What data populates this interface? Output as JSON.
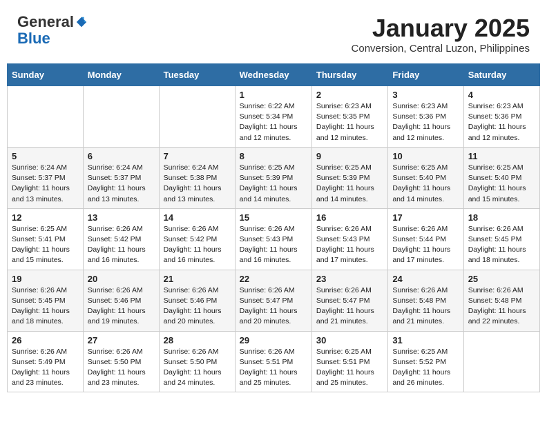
{
  "header": {
    "logo_line1": "General",
    "logo_line2": "Blue",
    "title": "January 2025",
    "location": "Conversion, Central Luzon, Philippines"
  },
  "weekdays": [
    "Sunday",
    "Monday",
    "Tuesday",
    "Wednesday",
    "Thursday",
    "Friday",
    "Saturday"
  ],
  "weeks": [
    [
      {
        "day": "",
        "sunrise": "",
        "sunset": "",
        "daylight": ""
      },
      {
        "day": "",
        "sunrise": "",
        "sunset": "",
        "daylight": ""
      },
      {
        "day": "",
        "sunrise": "",
        "sunset": "",
        "daylight": ""
      },
      {
        "day": "1",
        "sunrise": "Sunrise: 6:22 AM",
        "sunset": "Sunset: 5:34 PM",
        "daylight": "Daylight: 11 hours and 12 minutes."
      },
      {
        "day": "2",
        "sunrise": "Sunrise: 6:23 AM",
        "sunset": "Sunset: 5:35 PM",
        "daylight": "Daylight: 11 hours and 12 minutes."
      },
      {
        "day": "3",
        "sunrise": "Sunrise: 6:23 AM",
        "sunset": "Sunset: 5:36 PM",
        "daylight": "Daylight: 11 hours and 12 minutes."
      },
      {
        "day": "4",
        "sunrise": "Sunrise: 6:23 AM",
        "sunset": "Sunset: 5:36 PM",
        "daylight": "Daylight: 11 hours and 12 minutes."
      }
    ],
    [
      {
        "day": "5",
        "sunrise": "Sunrise: 6:24 AM",
        "sunset": "Sunset: 5:37 PM",
        "daylight": "Daylight: 11 hours and 13 minutes."
      },
      {
        "day": "6",
        "sunrise": "Sunrise: 6:24 AM",
        "sunset": "Sunset: 5:37 PM",
        "daylight": "Daylight: 11 hours and 13 minutes."
      },
      {
        "day": "7",
        "sunrise": "Sunrise: 6:24 AM",
        "sunset": "Sunset: 5:38 PM",
        "daylight": "Daylight: 11 hours and 13 minutes."
      },
      {
        "day": "8",
        "sunrise": "Sunrise: 6:25 AM",
        "sunset": "Sunset: 5:39 PM",
        "daylight": "Daylight: 11 hours and 14 minutes."
      },
      {
        "day": "9",
        "sunrise": "Sunrise: 6:25 AM",
        "sunset": "Sunset: 5:39 PM",
        "daylight": "Daylight: 11 hours and 14 minutes."
      },
      {
        "day": "10",
        "sunrise": "Sunrise: 6:25 AM",
        "sunset": "Sunset: 5:40 PM",
        "daylight": "Daylight: 11 hours and 14 minutes."
      },
      {
        "day": "11",
        "sunrise": "Sunrise: 6:25 AM",
        "sunset": "Sunset: 5:40 PM",
        "daylight": "Daylight: 11 hours and 15 minutes."
      }
    ],
    [
      {
        "day": "12",
        "sunrise": "Sunrise: 6:25 AM",
        "sunset": "Sunset: 5:41 PM",
        "daylight": "Daylight: 11 hours and 15 minutes."
      },
      {
        "day": "13",
        "sunrise": "Sunrise: 6:26 AM",
        "sunset": "Sunset: 5:42 PM",
        "daylight": "Daylight: 11 hours and 16 minutes."
      },
      {
        "day": "14",
        "sunrise": "Sunrise: 6:26 AM",
        "sunset": "Sunset: 5:42 PM",
        "daylight": "Daylight: 11 hours and 16 minutes."
      },
      {
        "day": "15",
        "sunrise": "Sunrise: 6:26 AM",
        "sunset": "Sunset: 5:43 PM",
        "daylight": "Daylight: 11 hours and 16 minutes."
      },
      {
        "day": "16",
        "sunrise": "Sunrise: 6:26 AM",
        "sunset": "Sunset: 5:43 PM",
        "daylight": "Daylight: 11 hours and 17 minutes."
      },
      {
        "day": "17",
        "sunrise": "Sunrise: 6:26 AM",
        "sunset": "Sunset: 5:44 PM",
        "daylight": "Daylight: 11 hours and 17 minutes."
      },
      {
        "day": "18",
        "sunrise": "Sunrise: 6:26 AM",
        "sunset": "Sunset: 5:45 PM",
        "daylight": "Daylight: 11 hours and 18 minutes."
      }
    ],
    [
      {
        "day": "19",
        "sunrise": "Sunrise: 6:26 AM",
        "sunset": "Sunset: 5:45 PM",
        "daylight": "Daylight: 11 hours and 18 minutes."
      },
      {
        "day": "20",
        "sunrise": "Sunrise: 6:26 AM",
        "sunset": "Sunset: 5:46 PM",
        "daylight": "Daylight: 11 hours and 19 minutes."
      },
      {
        "day": "21",
        "sunrise": "Sunrise: 6:26 AM",
        "sunset": "Sunset: 5:46 PM",
        "daylight": "Daylight: 11 hours and 20 minutes."
      },
      {
        "day": "22",
        "sunrise": "Sunrise: 6:26 AM",
        "sunset": "Sunset: 5:47 PM",
        "daylight": "Daylight: 11 hours and 20 minutes."
      },
      {
        "day": "23",
        "sunrise": "Sunrise: 6:26 AM",
        "sunset": "Sunset: 5:47 PM",
        "daylight": "Daylight: 11 hours and 21 minutes."
      },
      {
        "day": "24",
        "sunrise": "Sunrise: 6:26 AM",
        "sunset": "Sunset: 5:48 PM",
        "daylight": "Daylight: 11 hours and 21 minutes."
      },
      {
        "day": "25",
        "sunrise": "Sunrise: 6:26 AM",
        "sunset": "Sunset: 5:48 PM",
        "daylight": "Daylight: 11 hours and 22 minutes."
      }
    ],
    [
      {
        "day": "26",
        "sunrise": "Sunrise: 6:26 AM",
        "sunset": "Sunset: 5:49 PM",
        "daylight": "Daylight: 11 hours and 23 minutes."
      },
      {
        "day": "27",
        "sunrise": "Sunrise: 6:26 AM",
        "sunset": "Sunset: 5:50 PM",
        "daylight": "Daylight: 11 hours and 23 minutes."
      },
      {
        "day": "28",
        "sunrise": "Sunrise: 6:26 AM",
        "sunset": "Sunset: 5:50 PM",
        "daylight": "Daylight: 11 hours and 24 minutes."
      },
      {
        "day": "29",
        "sunrise": "Sunrise: 6:26 AM",
        "sunset": "Sunset: 5:51 PM",
        "daylight": "Daylight: 11 hours and 25 minutes."
      },
      {
        "day": "30",
        "sunrise": "Sunrise: 6:25 AM",
        "sunset": "Sunset: 5:51 PM",
        "daylight": "Daylight: 11 hours and 25 minutes."
      },
      {
        "day": "31",
        "sunrise": "Sunrise: 6:25 AM",
        "sunset": "Sunset: 5:52 PM",
        "daylight": "Daylight: 11 hours and 26 minutes."
      },
      {
        "day": "",
        "sunrise": "",
        "sunset": "",
        "daylight": ""
      }
    ]
  ]
}
